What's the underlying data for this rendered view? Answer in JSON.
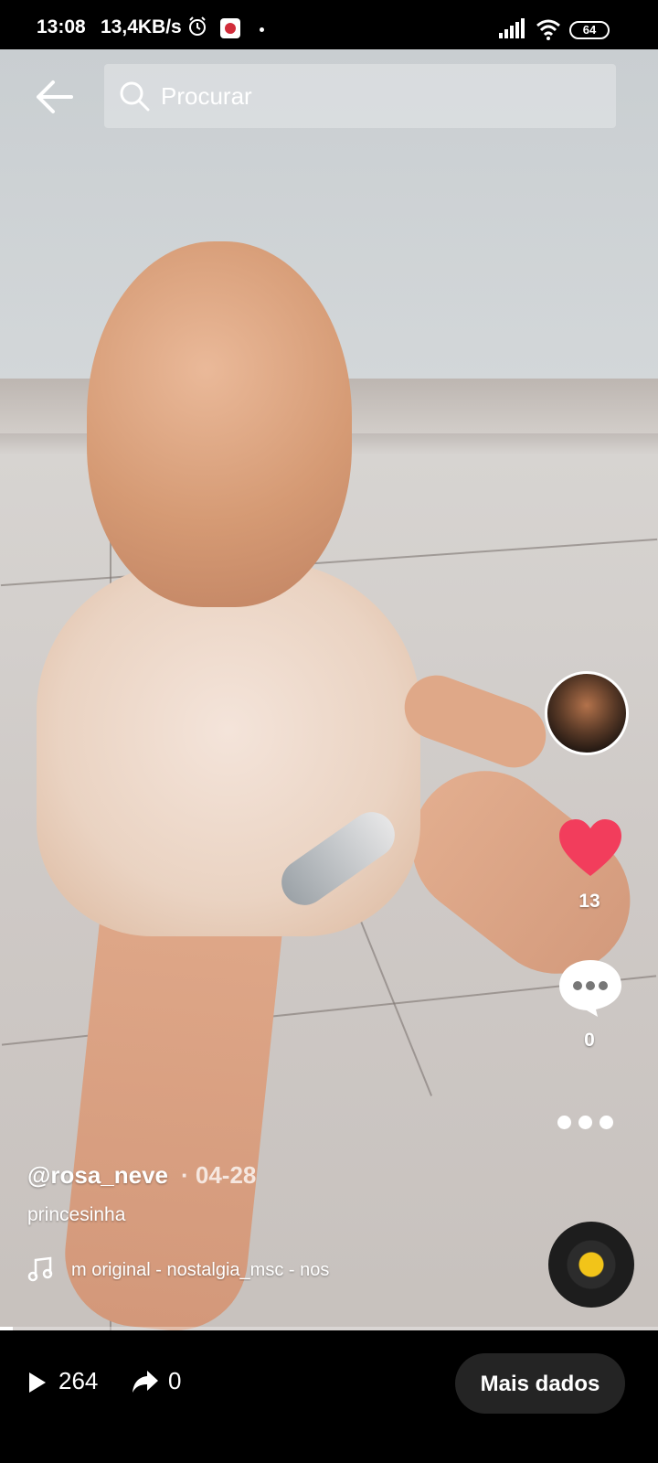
{
  "status_bar": {
    "time": "13:08",
    "network_speed": "13,4KB/s",
    "battery": "64"
  },
  "header": {
    "search_placeholder": "Procurar"
  },
  "actions": {
    "likes": "13",
    "comments": "0"
  },
  "caption": {
    "author": "@rosa_neve",
    "date": "· 04-28",
    "description": "princesinha",
    "music": "m original - nostalgia_msc - nos"
  },
  "playback": {
    "progress_fraction": 0.02
  },
  "stats": {
    "views": "264",
    "shares": "0",
    "more_data_label": "Mais dados"
  },
  "colors": {
    "like_heart": "#f23d5c",
    "accent_white": "#ffffff",
    "bottom_bar": "#000000"
  }
}
